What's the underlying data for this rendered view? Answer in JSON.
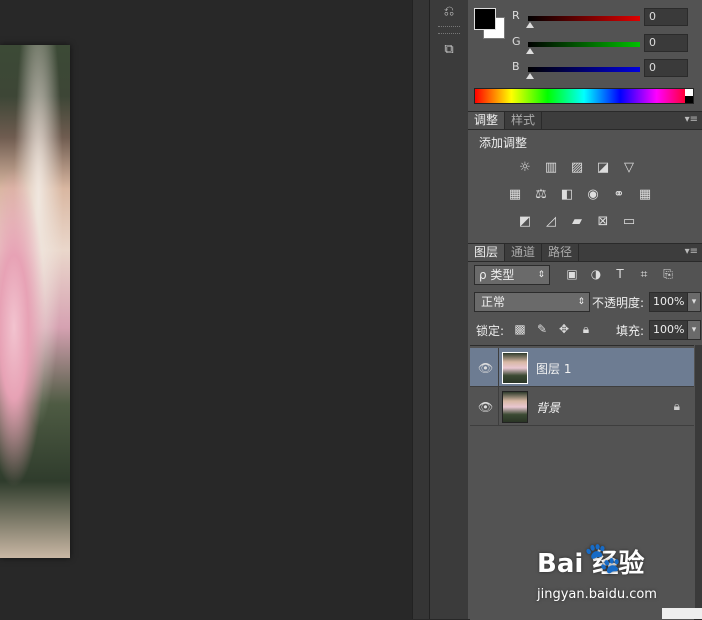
{
  "color": {
    "channels": [
      {
        "label": "R",
        "value": "0",
        "color": "#e00000"
      },
      {
        "label": "G",
        "value": "0",
        "color": "#00c000"
      },
      {
        "label": "B",
        "value": "0",
        "color": "#0000e0"
      }
    ]
  },
  "adjustments": {
    "tabs": [
      "调整",
      "样式"
    ],
    "title": "添加调整"
  },
  "layers": {
    "tabs": [
      "图层",
      "通道",
      "路径"
    ],
    "filter_label": "ρ 类型",
    "blend_mode": "正常",
    "opacity_label": "不透明度:",
    "opacity_value": "100%",
    "lock_label": "锁定:",
    "fill_label": "填充:",
    "fill_value": "100%",
    "items": [
      {
        "name": "图层 1",
        "selected": true
      },
      {
        "name": "背景",
        "locked": true
      }
    ]
  },
  "watermark": {
    "brand": "Bai  经验",
    "paw": "🐾",
    "url": "jingyan.baidu.com"
  },
  "colors": {
    "accent_selected": "#6d7c92",
    "panel_bg": "#535353",
    "canvas_bg": "#282828"
  }
}
